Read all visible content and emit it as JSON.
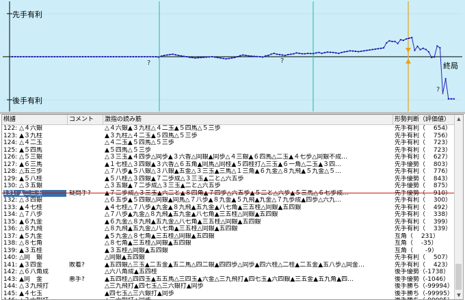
{
  "graph": {
    "label_top": "先手有利",
    "label_bottom": "後手有利",
    "label_end": "終局",
    "question_mark": "?",
    "colors": {
      "bg": "#cdeef8",
      "line": "#2222bb",
      "point": "#1a1aa8",
      "accent": "#e8a020",
      "red": "#e03030",
      "cursor": "#e0b040"
    },
    "chart_data": {
      "type": "line",
      "x": [
        0,
        1,
        2,
        3,
        4,
        5,
        6,
        7,
        8,
        9,
        10,
        11,
        12,
        13,
        14,
        15,
        16,
        17,
        18,
        19,
        20,
        21,
        22,
        23,
        24,
        25,
        26,
        27,
        28,
        29,
        30,
        31,
        32,
        33,
        34,
        35,
        36,
        37,
        38,
        39,
        40,
        41,
        42,
        43,
        44,
        45,
        46,
        47,
        48,
        49,
        50,
        51,
        52,
        53,
        54,
        55,
        56,
        57,
        58,
        59,
        60,
        61,
        62,
        63,
        64,
        65,
        66,
        67,
        68,
        69,
        70,
        71,
        72,
        73,
        74,
        75,
        76,
        77,
        78,
        79,
        80,
        81,
        82,
        83,
        84,
        85,
        86,
        87,
        88,
        89,
        90,
        91,
        92,
        93,
        94,
        95,
        96,
        97,
        98,
        99,
        100,
        101,
        102,
        103,
        104,
        105,
        106,
        107,
        108,
        109,
        110,
        111,
        112,
        113,
        114,
        115,
        116,
        117,
        118,
        119,
        120,
        121,
        122,
        123,
        124,
        125,
        126,
        127,
        128,
        129,
        130,
        131,
        132,
        133,
        134,
        135,
        136,
        137,
        138,
        139,
        140,
        141,
        142,
        143,
        144,
        145,
        146
      ],
      "values": [
        0,
        0,
        0,
        0,
        0,
        0,
        0,
        0,
        0,
        0,
        0,
        0,
        0,
        0,
        0,
        0,
        0,
        0,
        0,
        0,
        0,
        0,
        0,
        0,
        0,
        0,
        0,
        0,
        0,
        0,
        0,
        0,
        0,
        0,
        0,
        0,
        0,
        0,
        0,
        0,
        0,
        0,
        0,
        0,
        0,
        0,
        0,
        0,
        0,
        0,
        0,
        0,
        -20,
        30,
        60,
        80,
        100,
        120,
        90,
        60,
        40,
        20,
        0,
        -30,
        -40,
        -60,
        -50,
        -40,
        -30,
        -20,
        -10,
        0,
        -20,
        -40,
        -60,
        -80,
        -100,
        -80,
        -60,
        -40,
        0,
        50,
        80,
        60,
        40,
        30,
        20,
        10,
        0,
        -20,
        40,
        60,
        120,
        160,
        120,
        100,
        80,
        60,
        100,
        120,
        140,
        180,
        160,
        140,
        140,
        160,
        150,
        150,
        180,
        200,
        160,
        190,
        220,
        210,
        200,
        180,
        160,
        200,
        230,
        250,
        280,
        270,
        260,
        240,
        260,
        280,
        300,
        320,
        340,
        360,
        380,
        400,
        420,
        654,
        756,
        723,
        723,
        627,
        803,
        776,
        843,
        875,
        910,
        300,
        492,
        338,
        399,
        339,
        231,
        -35,
        -9,
        507,
        423,
        -1738,
        -1046,
        -99994,
        -99995,
        -99995
      ],
      "ylim": [
        -2000,
        2000
      ]
    }
  },
  "list": {
    "headers": [
      "棋譜",
      "コメント",
      "激指の読み筋",
      "形勢判断（評価値）"
    ],
    "rows": [
      {
        "move": "122: △４六銀",
        "comment": "",
        "line": "△４六銀▲３九柱△４二玉▲５四馬△５三歩",
        "eval": "先手有利（　 654）"
      },
      {
        "move": "123: ▲３九柱",
        "comment": "",
        "line": "▲３九柱△４二玉▲５四馬△５三歩",
        "eval": "先手有利（　 756）"
      },
      {
        "move": "124: △４二玉",
        "comment": "",
        "line": "△４二玉▲５四馬△５三歩",
        "eval": "先手有利（　 723）"
      },
      {
        "move": "125: ▲５四馬",
        "comment": "",
        "line": "▲５四馬△５三歩",
        "eval": "先手有利（　 723）"
      },
      {
        "move": "126: △５三銀",
        "comment": "",
        "line": "△３三玉▲４四歩△同歩▲３六香△同銀▲同歩△４三銀▲６四馬△二玉▲４七歩△同銀不成…",
        "eval": "先手有利（　 627）"
      },
      {
        "move": "127: ▲６三馬",
        "comment": "",
        "line": "▲１七桂△３四銀▲３六香△６五角▲同馬△同桂▲５四桂打△三玉▲６一角△二玉▲３四…",
        "eval": "先手優勢（　 803）"
      },
      {
        "move": "128: △五三歩",
        "comment": "",
        "line": "△７八歩▲５八銀△３八銀▲五金△３三玉▲三馬△１三角▲６九金△８九飛▲５九金△５…",
        "eval": "先手有利（　 776）"
      },
      {
        "move": "129: ▲５八桂",
        "comment": "",
        "line": "▲５八桂△３四銀▲７二歩成△３三玉▲二と△六五歩",
        "eval": "先手優勢（　 843）"
      },
      {
        "move": "130: △３五銀",
        "comment": "",
        "line": "△３五銀▲７二歩成△３三玉▲二と△六五歩",
        "eval": "先手優勢（　 875）"
      },
      {
        "move": "131: ▲二三玉",
        "comment": "疑問手?",
        "line": "▲７二歩成△３三玉▲六二と▲８四角▲７四歩△六五歩▲５二と△六歩▲５三馬△６七歩成…",
        "eval": "先手優勢（　 910）"
      },
      {
        "move": "132: △３四銀",
        "comment": "",
        "line": "△６五歩▲５四銀△同銀▲同馬△７八歩▲８九金▲５九飛▲九金△７九歩成▲四歩△六九…",
        "eval": "先手有利（　 300）"
      },
      {
        "move": "133: ▲４七桂",
        "comment": "",
        "line": "▲４七桂△７八歩▲九金▲８九飛▲五九金▲八七角▲三五桂△同銀▲五四銀",
        "eval": "先手有利（　 492）"
      },
      {
        "move": "134: △７八歩",
        "comment": "",
        "line": "△７八歩▲九金△８九飛▲五九金▲八七角▲三五桂△同銀▲五四銀",
        "eval": "先手有利（　 338）"
      },
      {
        "move": "135: ▲６九金",
        "comment": "",
        "line": "▲６九金△８九飛▲五九金△八七角▲三五桂△同銀▲五四銀",
        "eval": "先手有利（　 399）"
      },
      {
        "move": "136: △８九飛",
        "comment": "",
        "line": "△８九飛▲五九金△八七角▲三五桂△同銀▲五四銀",
        "eval": "先手有利（　 339）"
      },
      {
        "move": "137: ▲５九金",
        "comment": "",
        "line": "▲５九金△８七角▲三五桂△同銀▲五四銀",
        "eval": "互角（　 231）"
      },
      {
        "move": "138: △８七角",
        "comment": "",
        "line": "△８七角▲三五桂△同銀▲五四銀",
        "eval": "互角（　 -35）"
      },
      {
        "move": "139: ▲３五桂",
        "comment": "",
        "line": "▲３五桂△同銀▲五四銀",
        "eval": "互角（　　-9）"
      },
      {
        "move": "140: △同　銀",
        "comment": "",
        "line": "△同銀▲五四銀",
        "eval": "先手有利（　 507）"
      },
      {
        "move": "141: ▲３四金",
        "comment": "敗着?",
        "line": "▲五四銀△三玉▲二五金▲五二馬△四二銀▲四四歩△同歩▲四六桂△二桂▲二五金▲五八歩△同金…",
        "eval": "先手有利（　 423）"
      },
      {
        "move": "142: △６八角成",
        "comment": "",
        "line": "△六八角成▲五四桂",
        "eval": "後手優勢（-1738）"
      },
      {
        "move": "143: ▲同　金",
        "comment": "悪手?",
        "line": "▲五四桂△四四玉▲五五馬△三四玉▲六金△三九飛打▲四七玉▲六四銀▲三五金▲五九角▲四…",
        "eval": "後手優勢（-1046）"
      },
      {
        "move": "144: △３九飛打",
        "comment": "",
        "line": "△三九飛打▲四七玉△三六銀打▲同歩",
        "eval": "後手勝ち（-99994）"
      },
      {
        "move": "145: ▲４七玉",
        "comment": "",
        "line": "▲四七玉△三六銀打▲同歩",
        "eval": "後手勝ち（-99995）"
      },
      {
        "move": "146: △３六銀打",
        "comment": "",
        "line": "△三六銀打▲同歩",
        "eval": "後手勝ち（-99995）"
      }
    ]
  }
}
